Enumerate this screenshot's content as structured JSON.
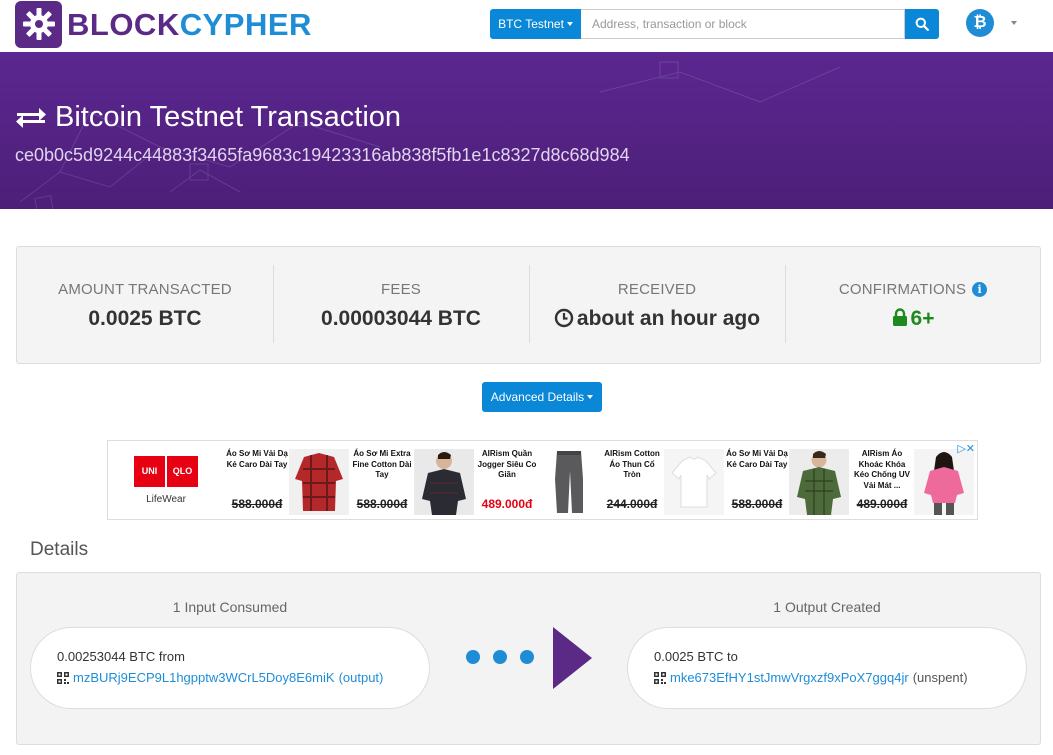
{
  "brand": {
    "part1": "BLOCK",
    "part2": "CYPHER",
    "primary_color": "#5b2a86",
    "accent_color": "#1f8dd6"
  },
  "nav": {
    "network_button": "BTC Testnet",
    "search_placeholder": "Address, transaction or block",
    "currency_icon": "bitcoin-icon"
  },
  "banner": {
    "title": "Bitcoin Testnet Transaction",
    "hash": "ce0b0c5d9244c44883f3465fa9683c19423316ab838f5fb1e1c8327d8c68d984"
  },
  "summary": {
    "amount_label": "AMOUNT TRANSACTED",
    "amount_value": "0.0025 BTC",
    "fees_label": "FEES",
    "fees_value": "0.00003044 BTC",
    "received_label": "RECEIVED",
    "received_value": "about an hour ago",
    "confirmations_label": "CONFIRMATIONS",
    "confirmations_value": "6+"
  },
  "advanced_button": "Advanced Details",
  "ad": {
    "brand_left": "UNI",
    "brand_right": "QLO",
    "brand_sub": "LifeWear",
    "items": [
      {
        "name": "Áo Sơ Mi Vải Dạ Kẻ Caro Dài Tay",
        "price": "588.000đ",
        "sale": false
      },
      {
        "name": "Áo Sơ Mi Extra Fine Cotton Dài Tay",
        "price": "588.000đ",
        "sale": false
      },
      {
        "name": "AIRism Quần Jogger Siêu Co Giãn",
        "price": "489.000đ",
        "sale": true
      },
      {
        "name": "AIRism Cotton Áo Thun Cổ Tròn",
        "price": "244.000đ",
        "sale": false
      },
      {
        "name": "Áo Sơ Mi Vải Dạ Kẻ Caro Dài Tay",
        "price": "588.000đ",
        "sale": false
      },
      {
        "name": "AIRism Áo Khoác Khóa Kéo Chống UV Vải Mát ...",
        "price": "489.000đ",
        "sale": false
      }
    ]
  },
  "details": {
    "title": "Details",
    "inputs_head": "1 Input Consumed",
    "outputs_head": "1 Output Created",
    "input": {
      "amount": "0.00253044 BTC",
      "word": "from",
      "address": "mzBURj9ECP9L1hgpptw3WCrL5Doy8E6miK",
      "tag": "(output)"
    },
    "output": {
      "amount": "0.0025 BTC",
      "word": "to",
      "address": "mke673EfHY1stJmwVrgxzf9xPoX7ggq4jr",
      "tag": "(unspent)"
    }
  }
}
